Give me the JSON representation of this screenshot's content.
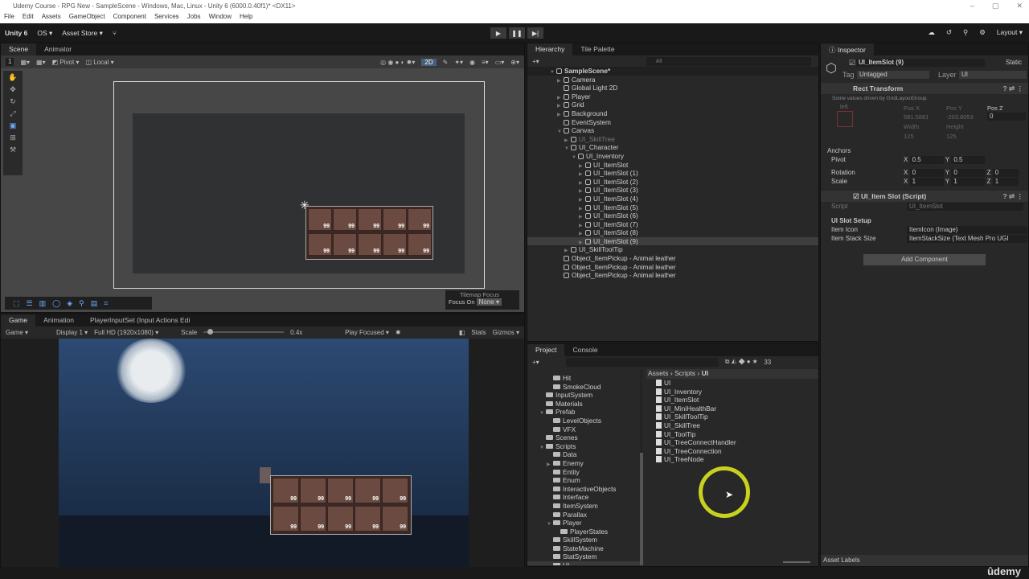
{
  "window": {
    "title": "Udemy Course - RPG New - SampleScene - Windows, Mac, Linux - Unity 6 (6000.0.40f1)* <DX11>"
  },
  "menu": [
    "File",
    "Edit",
    "Assets",
    "GameObject",
    "Component",
    "Services",
    "Jobs",
    "Window",
    "Help"
  ],
  "toolbar": {
    "account": "Unity 6",
    "os": "OS",
    "asset_store": "Asset Store",
    "layout": "Layout"
  },
  "scene": {
    "tabs": [
      "Scene",
      "Animator"
    ],
    "layer_num": "1",
    "pivot": "Pivot",
    "local": "Local",
    "mode2d": "2D",
    "tilemap_focus": "Tilemap Focus",
    "focus_on": "Focus On",
    "focus_value": "None"
  },
  "game": {
    "tabs": [
      "Game",
      "Animation",
      "PlayerInputSet (Input Actions Edi"
    ],
    "mode": "Game",
    "display": "Display 1",
    "resolution": "Full HD (1920x1080)",
    "scale_label": "Scale",
    "scale_value": "0.4x",
    "scale_fraction": 0.05,
    "play_focused": "Play Focused",
    "stats": "Stats",
    "gizmos": "Gizmos"
  },
  "inventory_slots": [
    "99",
    "99",
    "99",
    "99",
    "99",
    "99",
    "99",
    "99",
    "99",
    "99"
  ],
  "hierarchy": {
    "tabs": [
      "Hierarchy",
      "Tile Palette"
    ],
    "search_placeholder": "All",
    "items": [
      {
        "label": "SampleScene*",
        "depth": 0,
        "arrow": "open",
        "scene": true
      },
      {
        "label": "Camera",
        "depth": 1,
        "arrow": "closed"
      },
      {
        "label": "Global Light 2D",
        "depth": 1,
        "arrow": ""
      },
      {
        "label": "Player",
        "depth": 1,
        "arrow": "closed"
      },
      {
        "label": "Grid",
        "depth": 1,
        "arrow": "closed"
      },
      {
        "label": "Background",
        "depth": 1,
        "arrow": "closed"
      },
      {
        "label": "EventSystem",
        "depth": 1,
        "arrow": ""
      },
      {
        "label": "Canvas",
        "depth": 1,
        "arrow": "open"
      },
      {
        "label": "UI_SkillTree",
        "depth": 2,
        "arrow": "closed",
        "disabled": true
      },
      {
        "label": "UI_Character",
        "depth": 2,
        "arrow": "open"
      },
      {
        "label": "UI_Inventory",
        "depth": 3,
        "arrow": "open"
      },
      {
        "label": "UI_ItemSlot",
        "depth": 4,
        "arrow": "closed"
      },
      {
        "label": "UI_ItemSlot (1)",
        "depth": 4,
        "arrow": "closed"
      },
      {
        "label": "UI_ItemSlot (2)",
        "depth": 4,
        "arrow": "closed"
      },
      {
        "label": "UI_ItemSlot (3)",
        "depth": 4,
        "arrow": "closed"
      },
      {
        "label": "UI_ItemSlot (4)",
        "depth": 4,
        "arrow": "closed"
      },
      {
        "label": "UI_ItemSlot (5)",
        "depth": 4,
        "arrow": "closed"
      },
      {
        "label": "UI_ItemSlot (6)",
        "depth": 4,
        "arrow": "closed"
      },
      {
        "label": "UI_ItemSlot (7)",
        "depth": 4,
        "arrow": "closed"
      },
      {
        "label": "UI_ItemSlot (8)",
        "depth": 4,
        "arrow": "closed"
      },
      {
        "label": "UI_ItemSlot (9)",
        "depth": 4,
        "arrow": "closed",
        "selected": true
      },
      {
        "label": "UI_SkillToolTip",
        "depth": 2,
        "arrow": "closed"
      },
      {
        "label": "Object_ItemPickup - Animal leather",
        "depth": 1,
        "arrow": ""
      },
      {
        "label": "Object_ItemPickup - Animal leather",
        "depth": 1,
        "arrow": ""
      },
      {
        "label": "Object_ItemPickup - Animal leather",
        "depth": 1,
        "arrow": ""
      }
    ]
  },
  "project": {
    "tabs": [
      "Project",
      "Console"
    ],
    "count": "33",
    "breadcrumb": [
      "Assets",
      "Scripts",
      "UI"
    ],
    "folders": [
      {
        "label": "Hit",
        "depth": 2,
        "arrow": ""
      },
      {
        "label": "SmokeCloud",
        "depth": 2,
        "arrow": ""
      },
      {
        "label": "InputSystem",
        "depth": 1,
        "arrow": ""
      },
      {
        "label": "Materials",
        "depth": 1,
        "arrow": ""
      },
      {
        "label": "Prefab",
        "depth": 1,
        "arrow": "open"
      },
      {
        "label": "LevelObjects",
        "depth": 2,
        "arrow": ""
      },
      {
        "label": "VFX",
        "depth": 2,
        "arrow": ""
      },
      {
        "label": "Scenes",
        "depth": 1,
        "arrow": ""
      },
      {
        "label": "Scripts",
        "depth": 1,
        "arrow": "open"
      },
      {
        "label": "Data",
        "depth": 2,
        "arrow": ""
      },
      {
        "label": "Enemy",
        "depth": 2,
        "arrow": "closed"
      },
      {
        "label": "Entity",
        "depth": 2,
        "arrow": ""
      },
      {
        "label": "Enum",
        "depth": 2,
        "arrow": ""
      },
      {
        "label": "InteractiveObjects",
        "depth": 2,
        "arrow": ""
      },
      {
        "label": "Interface",
        "depth": 2,
        "arrow": ""
      },
      {
        "label": "ItemSystem",
        "depth": 2,
        "arrow": ""
      },
      {
        "label": "Parallax",
        "depth": 2,
        "arrow": ""
      },
      {
        "label": "Player",
        "depth": 2,
        "arrow": "open"
      },
      {
        "label": "PlayerStates",
        "depth": 3,
        "arrow": ""
      },
      {
        "label": "SkillSystem",
        "depth": 2,
        "arrow": ""
      },
      {
        "label": "StateMachine",
        "depth": 2,
        "arrow": ""
      },
      {
        "label": "StatSystem",
        "depth": 2,
        "arrow": ""
      },
      {
        "label": "UI",
        "depth": 2,
        "arrow": "",
        "selected": true
      }
    ],
    "files": [
      "UI",
      "UI_Inventory",
      "UI_ItemSlot",
      "UI_MiniHealthBar",
      "UI_SkillToolTip",
      "UI_SkillTree",
      "UI_ToolTip",
      "UI_TreeConnectHandler",
      "UI_TreeConnection",
      "UI_TreeNode"
    ]
  },
  "inspector": {
    "tab": "Inspector",
    "object_name": "UI_ItemSlot (9)",
    "static": "Static",
    "tag_label": "Tag",
    "tag": "Untagged",
    "layer_label": "Layer",
    "layer": "UI",
    "rect": {
      "title": "Rect Transform",
      "note": "Some values driven by GridLayoutGroup.",
      "anchor_h": "left",
      "anchor_v": "top",
      "posx_label": "Pos X",
      "posy_label": "Pos Y",
      "posz_label": "Pos Z",
      "posx": "581.5881",
      "posy": "-203.8053",
      "posz": "0",
      "width_label": "Width",
      "height_label": "Height",
      "width": "125",
      "height": "125",
      "anchors": "Anchors",
      "pivot": "Pivot",
      "pivot_x": "0.5",
      "pivot_y": "0.5",
      "rotation": "Rotation",
      "rot_x": "0",
      "rot_y": "0",
      "rot_z": "0",
      "scale": "Scale",
      "scale_x": "1",
      "scale_y": "1",
      "scale_z": "1"
    },
    "script": {
      "title": "UI_Item Slot (Script)",
      "script_label": "Script",
      "script_value": "UI_ItemSlot",
      "section": "UI Slot Setup",
      "icon_label": "Item Icon",
      "icon_value": "ItemIcon (Image)",
      "stack_label": "Item Stack Size",
      "stack_value": "ItemStackSize (Text Mesh Pro UGI"
    },
    "add_component": "Add Component",
    "asset_labels": "Asset Labels"
  },
  "watermark": "udemy",
  "colors": {
    "accent": "#4a90d9",
    "cursor_ring": "#c8d21e"
  }
}
